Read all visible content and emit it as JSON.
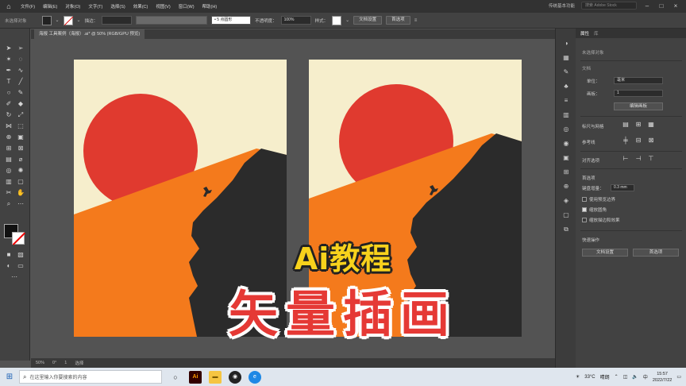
{
  "menubar": {
    "items": [
      "文件(F)",
      "编辑(E)",
      "对象(O)",
      "文字(T)",
      "选择(S)",
      "效果(C)",
      "视图(V)",
      "窗口(W)",
      "帮助(H)"
    ],
    "workspace": "传统基本功能",
    "search_placeholder": "搜索 Adobe Stock"
  },
  "controlbar": {
    "no_selection": "未选择对象",
    "stroke_label": "描边：",
    "stroke_value": "",
    "brush_value": "• 5 点圆形",
    "opacity_label": "不透明度：",
    "opacity_value": "100%",
    "style_label": "样式：",
    "doc_setup": "文档设置",
    "prefs": "首选项"
  },
  "document": {
    "tab_label": "海报 工具案例（海报）.ai* @ 50% (RGB/GPU 预览)"
  },
  "statusbar": {
    "zoom": "50%",
    "angle": "0°",
    "page": "1",
    "tool": "选择"
  },
  "panel": {
    "tab_properties": "属性",
    "tab_libraries": "库",
    "no_selection": "未选择对象",
    "document_hdr": "文档",
    "units_label": "单位：",
    "units_value": "毫米",
    "artboard_label": "画板：",
    "artboard_value": "1",
    "edit_artboard": "编辑画板",
    "ruler_grid_hdr": "标尺与网格",
    "guides_hdr": "参考线",
    "align_hdr": "对齐选项",
    "prefs_hdr": "首选项",
    "keyboard_inc_label": "键盘增量：",
    "keyboard_inc_value": "0.3 mm",
    "check_preview_bounds": "使用预览边界",
    "check_scale_corners": "缩放圆角",
    "check_scale_strokes": "缩放描边和效果",
    "quick_actions_hdr": "快速操作",
    "quick_doc_setup": "文档设置",
    "quick_prefs": "首选项"
  },
  "overlay": {
    "title": "Ai教程",
    "subtitle": "矢量插画"
  },
  "taskbar": {
    "search_placeholder": "在这里输入你要搜索的内容",
    "temperature": "33°C",
    "weather": "晴朗",
    "time": "15:57",
    "date": "2022/7/22",
    "lang": "中"
  },
  "colors": {
    "artboard_bg": "#f6eecc",
    "sun": "#e03a2f",
    "dune": "#f47a1c",
    "silhouette": "#2b2b2b",
    "title_yellow": "#f8d21c",
    "subtitle_red": "#e53935"
  }
}
